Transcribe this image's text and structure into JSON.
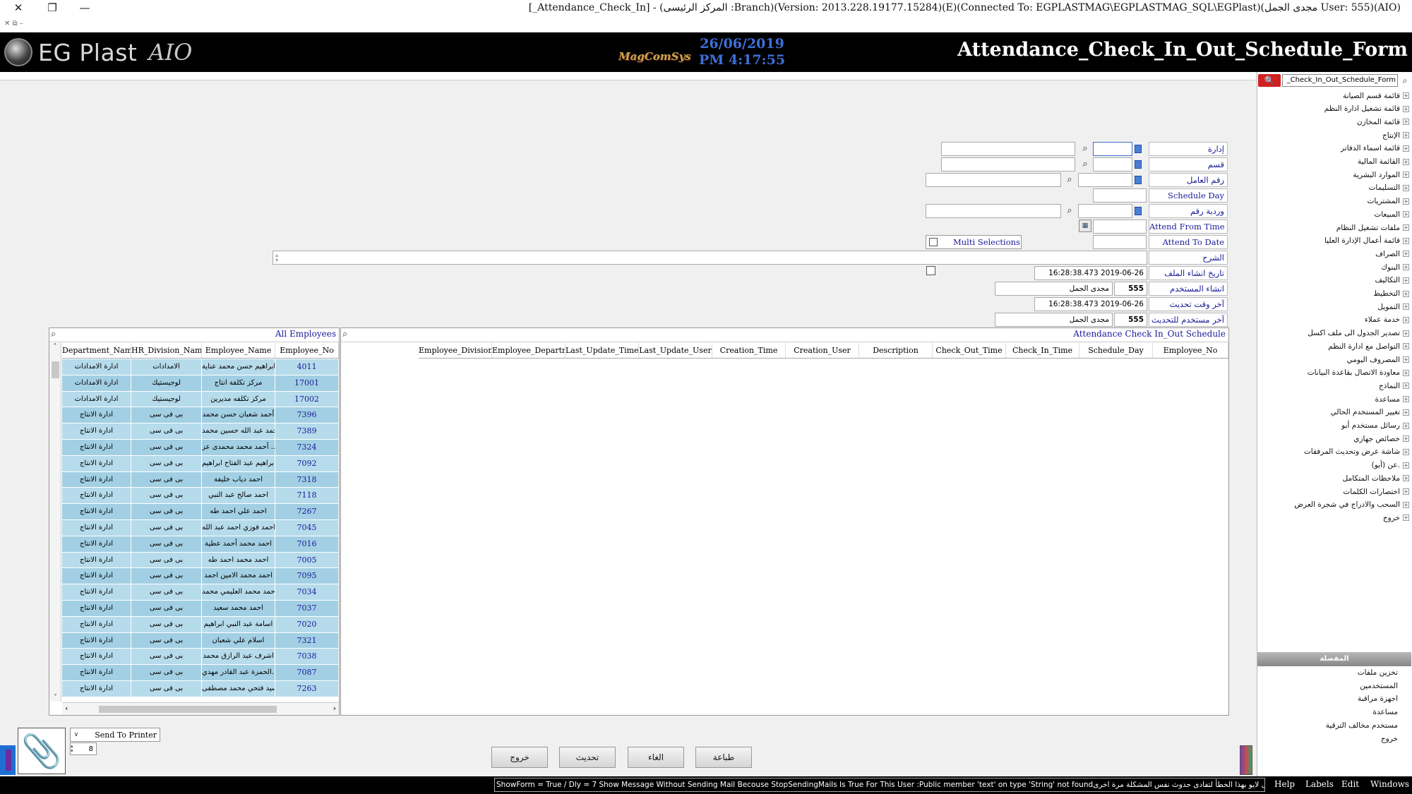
{
  "window": {
    "title": "[_Attendance_Check_In] - (المركز الرئيسى :Branch)(Version: 2013.228.19177.15284)(E)(Connected To: EGPLASTMAG\\EGPLASTMAG_SQL\\EGPlast)(مجدى الجمل User: 555)(AIO)",
    "close": "✕",
    "restore": "❐",
    "minimize": "—",
    "mini_icons": "✕ ⧉ –"
  },
  "header": {
    "logo_text": "EG Plast",
    "logo_sub": "AIO",
    "brand2": "MagComSys",
    "date": "26/06/2019",
    "time": "PM 4:17:55",
    "form_title": "Attendance_Check_In_Out_Schedule_Form"
  },
  "right_panel": {
    "search_value": "_Check_In_Out_Schedule_Form",
    "search_icon": "🔍",
    "items": [
      "قائمة قسم الصيانة",
      "قائمة تشغيل ادارة النظم",
      "قائمة المخازن",
      "الإنتاج",
      "قائمة اسماء الدفاتر",
      "القائمة المالية",
      "الموارد البشرية",
      "التسليمات",
      "المشتريات",
      "المبيعات",
      "ملفات تشغيل النظام",
      "قائمة أعمال الإدارة العليا",
      "الصراف",
      "البنوك",
      "التكاليف",
      "التخطيط",
      "التمويل",
      "خدمة عملاء",
      "تصدير الجدول الى ملف اكسل",
      "التواصل مع ادارة النظم",
      "المصروف اليومي",
      "معاودة الاتصال بقاعدة البيانات",
      "النماذج",
      "مساعدة",
      "تغيير المستخدم الحالي",
      "رسائل مستخدم أبو",
      "خصائص جهازي",
      "شاشة عرض وتحديث المرفقات",
      "عن (أيو).",
      "ملاحظات المتكامل",
      "اختصارات الكلمات",
      "السحب والادراج في شجرة العرض",
      "خروج"
    ],
    "favorites_header": "المفضلة",
    "favorites": [
      "تخزين ملفات",
      "المستخدمين",
      "اجهزة مراقبة",
      "مساعدة",
      "مستخدم مخالف الترقية",
      "خروج"
    ]
  },
  "form": {
    "labels": {
      "department": "إدارة",
      "section": "قسم",
      "employee_no": "رقم العامل",
      "schedule_day": "Schedule Day",
      "shift_no": "وردية رقم",
      "attend_from_time": "Attend From Time",
      "attend_to_date": "Attend To Date",
      "description": "الشرح",
      "creation_date": "تاريخ انشاء الملف",
      "created_by": "انشاء المستخدم",
      "last_update_time": "آخر وقت تحديث",
      "last_update_user": "آخر مستخدم للتحديث"
    },
    "multi_selections": "Multi Selections",
    "creation_time_value": "16:28:38.473 2019-06-26",
    "user_name": "مجدى الجمل",
    "user_no": "555",
    "update_time_value": "16:28:38.473 2019-06-26",
    "update_user_name": "مجدى الجمل",
    "update_user_no": "555"
  },
  "employees": {
    "title": "All Employees",
    "columns": [
      "Department_Name",
      "HR_Division_Name",
      "Employee_Name",
      "Employee_No"
    ],
    "rows": [
      [
        "ادارة الامدادات",
        "الامدادات",
        "ابراهيم حسن محمد عناية",
        "4011"
      ],
      [
        "ادارة الامدادات",
        "لوجيستيك",
        "مركز تكلفة انتاج",
        "17001"
      ],
      [
        "ادارة الامدادات",
        "لوجيستيك",
        "مركز تكلفه مديرين",
        "17002"
      ],
      [
        "ادارة الانتاج",
        "بى فى سى",
        "أحمد شعبان حسن محمد",
        "7396"
      ],
      [
        "ادارة الانتاج",
        "بى فى سى",
        "أحمد عبد الله حسين محمد",
        "7389"
      ],
      [
        "ادارة الانتاج",
        "بى فى سى",
        "أحمد محمد محمدى عز ...",
        "7324"
      ],
      [
        "ادارة الانتاج",
        "بى فى سى",
        "ابراهيم عبد الفتاح ابراهيم",
        "7092"
      ],
      [
        "ادارة الانتاج",
        "بى فى سى",
        "احمد دياب خليفة",
        "7318"
      ],
      [
        "ادارة الانتاج",
        "بى فى سى",
        "احمد صالح عبد النبي",
        "7118"
      ],
      [
        "ادارة الانتاج",
        "بى فى سى",
        "احمد علي احمد طه",
        "7267"
      ],
      [
        "ادارة الانتاج",
        "بى فى سى",
        "احمد فوزي احمد عبد الله",
        "7045"
      ],
      [
        "ادارة الانتاج",
        "بى فى سى",
        "احمد محمد أحمد عطية",
        "7016"
      ],
      [
        "ادارة الانتاج",
        "بى فى سى",
        "احمد محمد احمد طه",
        "7005"
      ],
      [
        "ادارة الانتاج",
        "بى فى سى",
        "احمد محمد الامين احمد",
        "7095"
      ],
      [
        "ادارة الانتاج",
        "بى فى سى",
        "احمد محمد العليمي محمد",
        "7034"
      ],
      [
        "ادارة الانتاج",
        "بى فى سى",
        "احمد محمد سعيد",
        "7037"
      ],
      [
        "ادارة الانتاج",
        "بى فى سى",
        "اسامة عبد النبي ابراهيم",
        "7020"
      ],
      [
        "ادارة الانتاج",
        "بى فى سى",
        "اسلام علي شعبان",
        "7321"
      ],
      [
        "ادارة الانتاج",
        "بى فى سى",
        "اشرف عبد الرازق محمد",
        "7038"
      ],
      [
        "ادارة الانتاج",
        "بى فى سى",
        "الحمزة عبد القادر مهدي...",
        "7087"
      ],
      [
        "ادارة الانتاج",
        "بى فى سى",
        "السيد فتحي محمد مصطفى",
        "7263"
      ]
    ]
  },
  "schedule": {
    "title": "Attendance Check In_Out Schedule",
    "columns": [
      "Employee_Division_Name",
      "Employee_Department_Name",
      "Last_Update_Time",
      "Last_Update_User",
      "Creation_Time",
      "Creation_User",
      "Description",
      "Check_Out_Time",
      "Check_In_Time",
      "Schedule_Day",
      "Employee_No"
    ]
  },
  "bottom": {
    "send_to_printer": "Send To Printer",
    "copies": "8",
    "buttons": {
      "exit": "خروج",
      "refresh": "تحديث",
      "cancel": "الغاء",
      "print": "طباعة"
    }
  },
  "status": {
    "message": "ShowForm = True / Dly = 7 Show Message Without Sending Mail Becouse StopSendingMails Is True For This User :Public member 'text' on type 'String' not foundمن فضلك أخبر فريق الدعم الفنى لايو بهذا الخطأ لتفادى حدوث نفس المشكلة مرة اخرى",
    "menus": [
      "Help",
      "Labels",
      "Edit",
      "Windows"
    ]
  }
}
